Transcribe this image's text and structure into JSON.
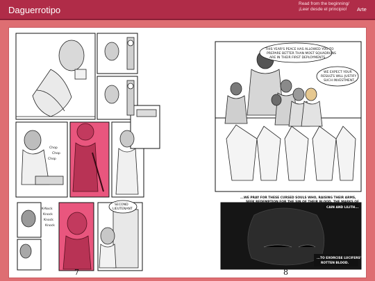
{
  "header": {
    "site_title": "Daguerrotipo",
    "read_link_line1": "Read from the beginning/",
    "read_link_line2": "¡Leer desde el principio!",
    "arte_label": "Arte"
  },
  "comic": {
    "left_page_number": "7",
    "right_page_number": "8",
    "sfx_chop": [
      "Chop",
      "Chop",
      "Chop"
    ],
    "sfx_knock": [
      "K-Nock",
      "Knock",
      "Knock",
      "Knock"
    ],
    "second_lieutenant": [
      "SECOND",
      "LIEUTENANT"
    ],
    "bubble_peace": [
      "THIS YEAR'S PEACE HAS ALLOWED YOU TO",
      "PREPARE BETTER THAN MOST SQUADRONS",
      "ARE IN THEIR FIRST DEPLOYMENTS"
    ],
    "bubble_results": [
      "WE EXPECT YOUR",
      "RESULTS WILL JUSTIFY",
      "SUCH INVESTMENT..."
    ],
    "caption_pray": [
      "...WE PRAY FOR THESE CURSED SOULS WHO, RAISING THEIR ARMS,",
      "SEEK REDEMPTION FOR THE SIN OF THEIR BLOOD, THE MARKS OF"
    ],
    "caption_cain": "CAIN AND LILITH...",
    "caption_dark": [
      "...TO EXORCISE LUCIFERS'",
      "ROTTEN BLOOD."
    ]
  },
  "colors": {
    "accent": "#b02c48",
    "background": "#de6e72",
    "pink_panel": "#e9567e"
  }
}
